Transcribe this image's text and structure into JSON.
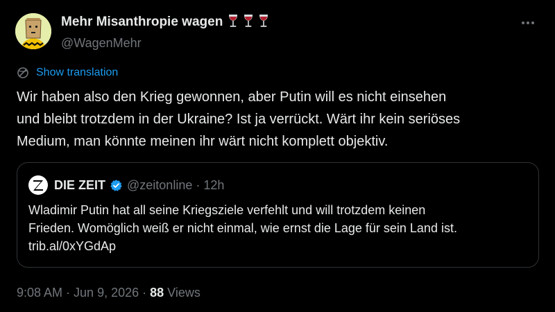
{
  "author": {
    "display_name": "Mehr Misanthropie wagen",
    "name_emoji_icons": [
      "wine-glass-icon",
      "wine-glass-icon",
      "wine-glass-icon"
    ],
    "handle": "@WagenMehr",
    "avatar_icon": "paper-bag-head-avatar"
  },
  "translation": {
    "label": "Show translation",
    "icon": "globe-translate-icon"
  },
  "body_lines": [
    "Wir haben also den Krieg gewonnen, aber Putin will es nicht einsehen",
    "und bleibt trotzdem in der Ukraine? Ist ja verrückt. Wärt ihr kein seriöses",
    "Medium, man könnte meinen ihr wärt nicht komplett objektiv."
  ],
  "quote": {
    "logo_letter": "Z",
    "name": "DIE ZEIT",
    "verified_icon": "verified-badge-icon",
    "handle": "@zeitonline",
    "separator": "·",
    "time": "12h",
    "text_lines": [
      "Wladimir Putin hat all seine Kriegsziele verfehlt und will trotzdem keinen",
      "Frieden. Womöglich weiß er nicht einmal, wie ernst die Lage für sein Land ist.",
      "trib.al/0xYGdAp"
    ]
  },
  "meta": {
    "time": "9:08 AM",
    "separator": "·",
    "date": "Jun 9, 2026",
    "views_count": "88",
    "views_label": "Views"
  },
  "colors": {
    "background": "#000000",
    "text": "#e7e9ea",
    "secondary": "#71767b",
    "accent": "#1d9bf0",
    "border": "#2f3336",
    "wine": "#b3202f"
  }
}
